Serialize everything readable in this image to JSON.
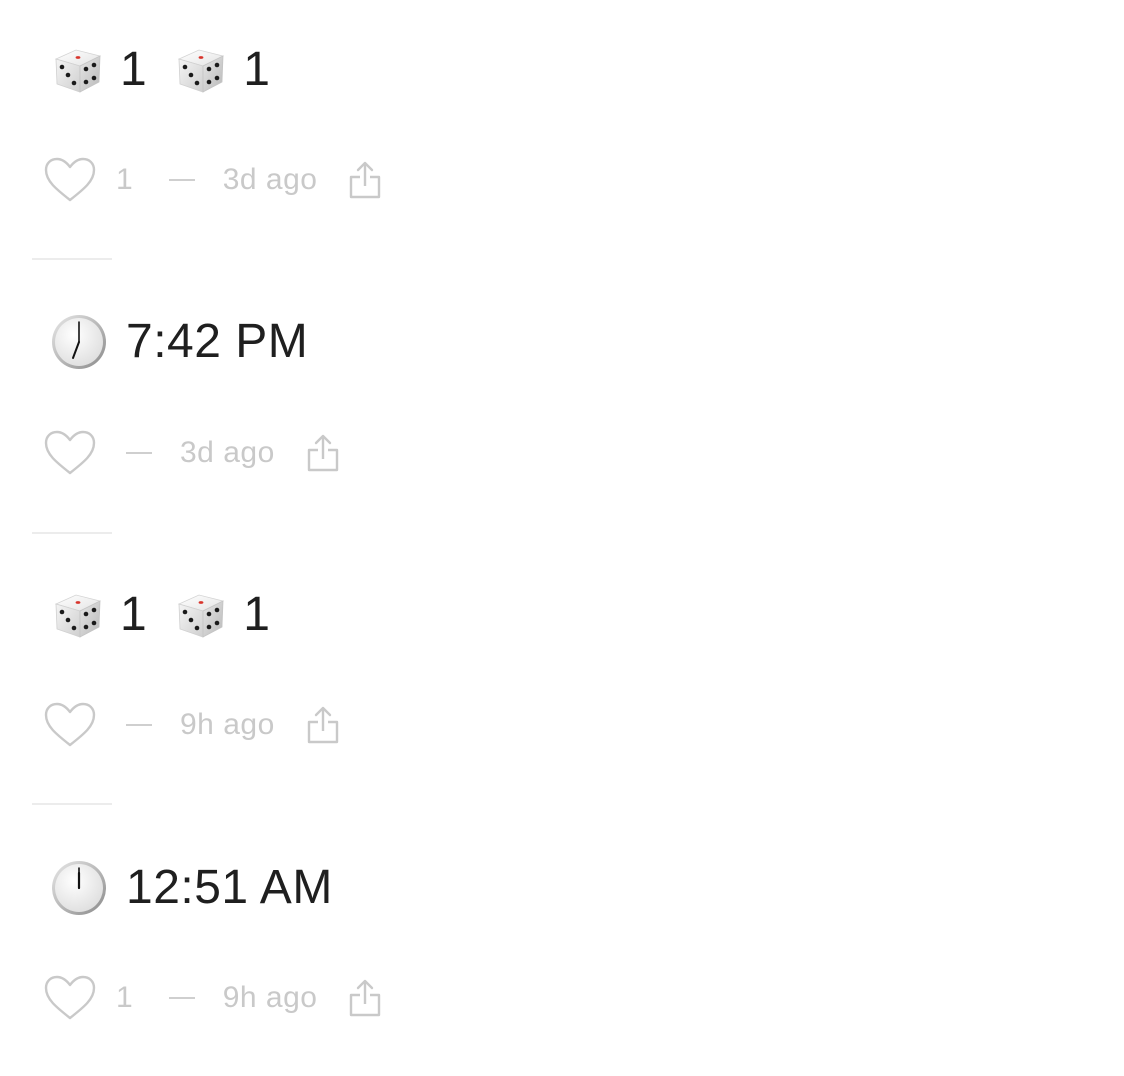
{
  "posts": [
    {
      "type": "dice",
      "dice": [
        "1",
        "1"
      ],
      "likes": "1",
      "time_ago": "3d ago"
    },
    {
      "type": "clock",
      "text": "7:42 PM",
      "likes": "",
      "time_ago": "3d ago"
    },
    {
      "type": "dice",
      "dice": [
        "1",
        "1"
      ],
      "likes": "",
      "time_ago": "9h ago"
    },
    {
      "type": "clock",
      "text": "12:51 AM",
      "likes": "1",
      "time_ago": "9h ago"
    }
  ],
  "icons": {
    "like": "heart-icon",
    "share": "share-icon",
    "die": "game-die-icon",
    "clock": "clock-icon"
  },
  "colors": {
    "muted": "#c9c9c9",
    "text": "#1f1f1f",
    "die_pip": "#1a1a1a",
    "die_center": "#d8342b"
  }
}
